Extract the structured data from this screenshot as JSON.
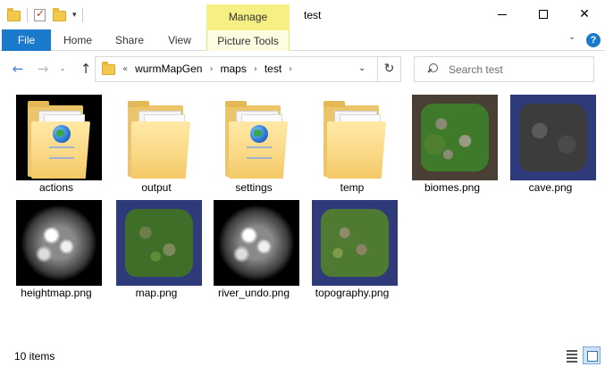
{
  "window": {
    "title": "test",
    "contextual_group": "Manage",
    "minimize_glyph": "—",
    "maximize_glyph": "☐",
    "close_glyph": "✕"
  },
  "quick_access": {
    "dropdown_glyph": "▾"
  },
  "ribbon": {
    "tabs": [
      {
        "label": "File",
        "active": true
      },
      {
        "label": "Home"
      },
      {
        "label": "Share"
      },
      {
        "label": "View"
      },
      {
        "label": "Picture Tools"
      }
    ],
    "collapse_glyph": "⌄",
    "help_glyph": "?"
  },
  "navigation": {
    "back_glyph": "←",
    "forward_glyph": "→",
    "recent_glyph": "⌄",
    "up_glyph": "↑",
    "breadcrumb_overflow": "«",
    "breadcrumb": [
      "wurmMapGen",
      "maps",
      "test"
    ],
    "breadcrumb_separator": "›",
    "address_dropdown_glyph": "⌄",
    "refresh_glyph": "↻",
    "search_placeholder": "Search test"
  },
  "items": [
    {
      "name": "actions",
      "kind": "folder",
      "icon": "folder-icon"
    },
    {
      "name": "output",
      "kind": "folder",
      "icon": "folder-icon"
    },
    {
      "name": "settings",
      "kind": "folder",
      "icon": "folder-icon"
    },
    {
      "name": "temp",
      "kind": "folder",
      "icon": "folder-icon"
    },
    {
      "name": "biomes.png",
      "kind": "image"
    },
    {
      "name": "cave.png",
      "kind": "image"
    },
    {
      "name": "heightmap.png",
      "kind": "image"
    },
    {
      "name": "map.png",
      "kind": "image"
    },
    {
      "name": "river_undo.png",
      "kind": "image"
    },
    {
      "name": "topography.png",
      "kind": "image"
    }
  ],
  "status": {
    "item_count": "10 items"
  },
  "colors": {
    "file_tab": "#1979ca",
    "manage_tab": "#f6f084",
    "ocean": "#2f3a7a"
  }
}
